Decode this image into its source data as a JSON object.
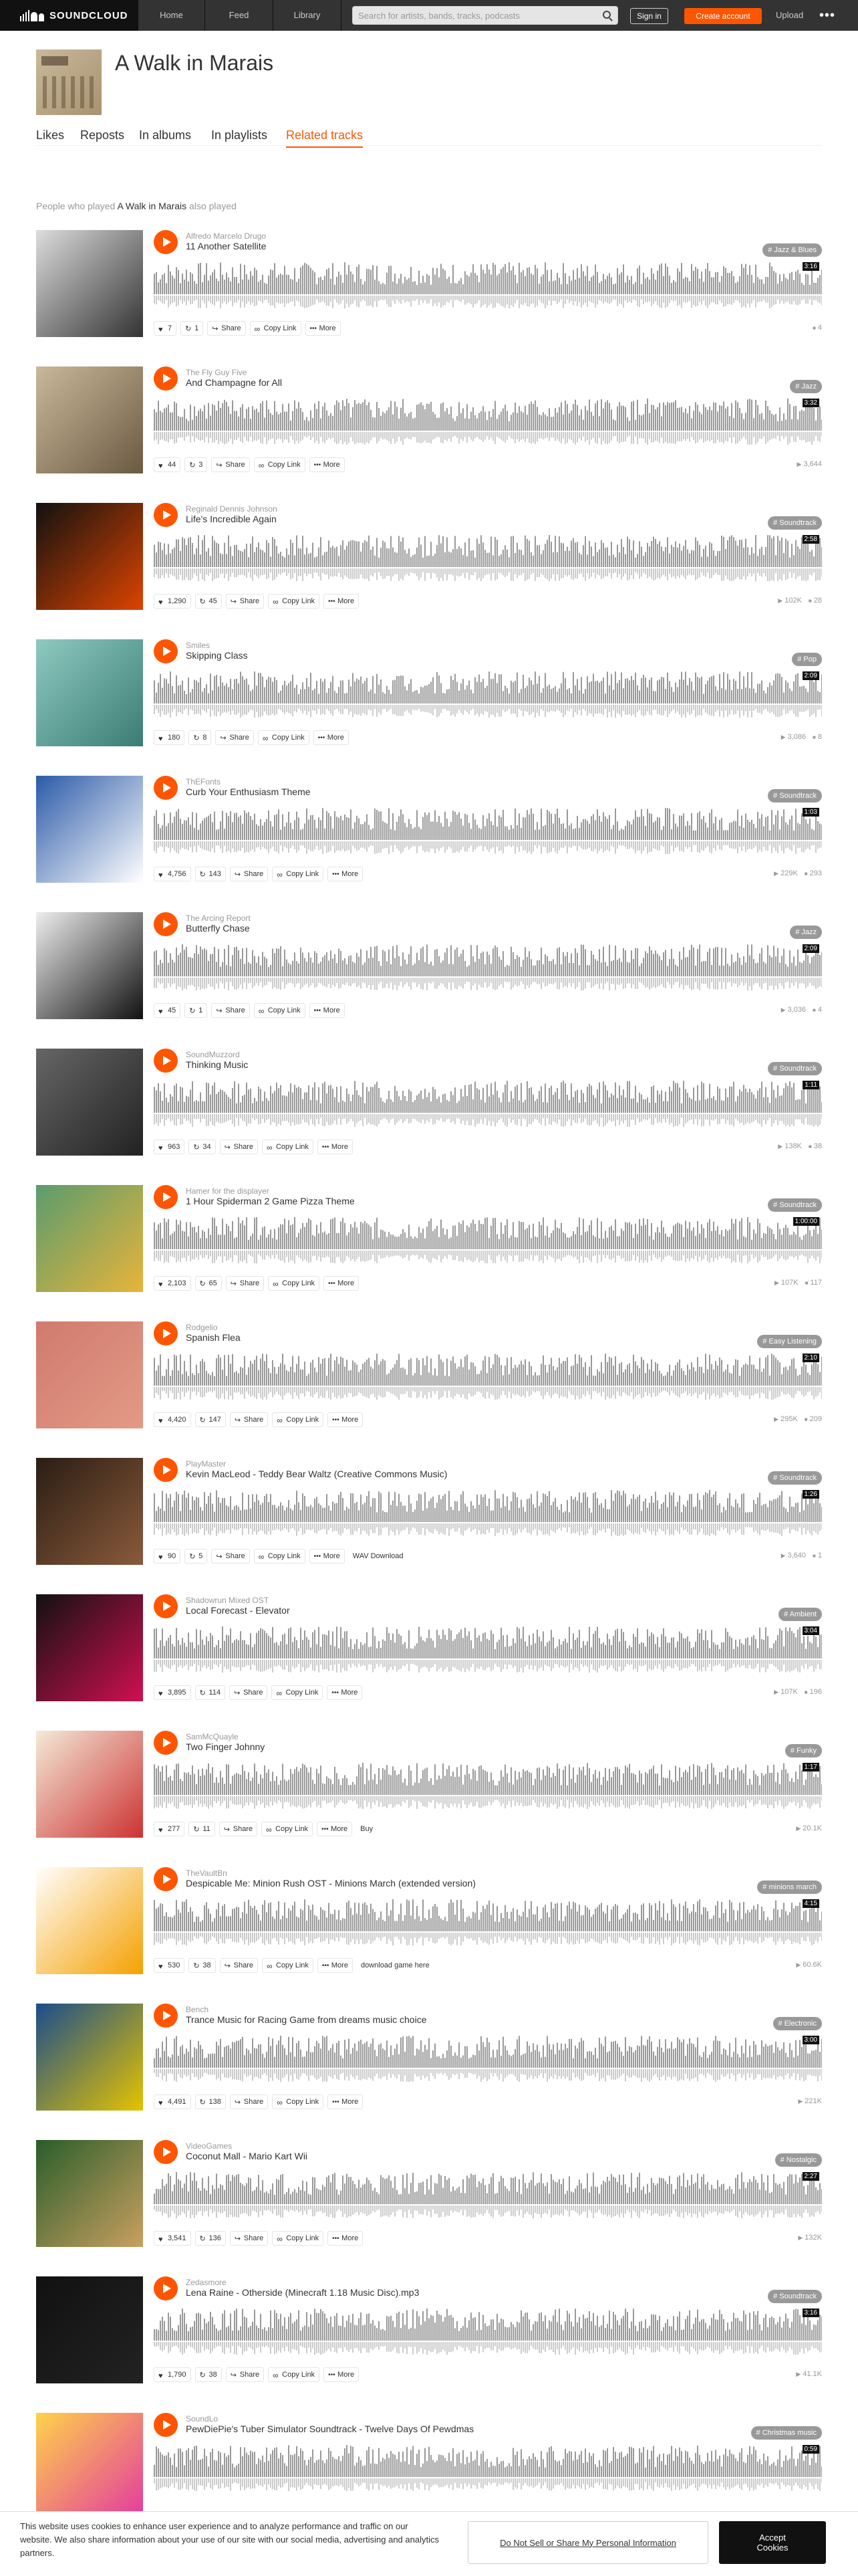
{
  "nav": {
    "logo_text": "SOUNDCLOUD",
    "home": "Home",
    "feed": "Feed",
    "library": "Library",
    "search_placeholder": "Search for artists, bands, tracks, podcasts",
    "sign_in": "Sign in",
    "create_account": "Create account",
    "upload": "Upload",
    "more": "•••"
  },
  "hero": {
    "title": "A Walk in Marais",
    "art": "album-cover-icon"
  },
  "tabs": [
    {
      "label": "Likes"
    },
    {
      "label": "Reposts"
    },
    {
      "label": "In albums"
    },
    {
      "label": "In playlists"
    },
    {
      "label": "Related tracks",
      "active": true
    }
  ],
  "heading": {
    "prefix": "People who played ",
    "track": "A Walk in Marais",
    "suffix": " also played"
  },
  "colors": {
    "accent": "#f50",
    "waveform": "#999",
    "nav_bg": "#333"
  },
  "tracks": [
    {
      "uploader": "Alfredo Marcelo Drugo",
      "title": "11 Another Satellite",
      "date": "",
      "tag": "# Jazz & Blues",
      "duration": "3:16",
      "likes": "7",
      "reposts": "1",
      "share": "Share",
      "copy_link": "Copy Link",
      "more": "More",
      "buy": "",
      "plays": "",
      "comments": "4",
      "art_colors": [
        "#ddd",
        "#333"
      ]
    },
    {
      "uploader": "The Fly Guy Five",
      "title": "And Champagne for All",
      "date": "",
      "tag": "# Jazz",
      "duration": "3:32",
      "likes": "44",
      "reposts": "3",
      "share": "Share",
      "copy_link": "Copy Link",
      "more": "More",
      "buy": "",
      "plays": "3,644",
      "comments": "",
      "art_colors": [
        "#c9b99a",
        "#6b5a43"
      ]
    },
    {
      "uploader": "Reginald Dennis Johnson",
      "title": "Life's Incredible Again",
      "date": "",
      "tag": "# Soundtrack",
      "duration": "2:58",
      "likes": "1,290",
      "reposts": "45",
      "share": "Share",
      "copy_link": "Copy Link",
      "more": "More",
      "buy": "",
      "plays": "102K",
      "comments": "28",
      "art_colors": [
        "#111",
        "#d40"
      ]
    },
    {
      "uploader": "Smiles",
      "title": "Skipping Class",
      "date": "",
      "tag": "# Pop",
      "duration": "2:09",
      "likes": "180",
      "reposts": "8",
      "share": "Share",
      "copy_link": "Copy Link",
      "more": "More",
      "buy": "",
      "plays": "3,086",
      "comments": "8",
      "art_colors": [
        "#8fc9c0",
        "#3a7d74"
      ]
    },
    {
      "uploader": "ThEFonts",
      "title": "Curb Your Enthusiasm Theme",
      "date": "",
      "tag": "# Soundtrack",
      "duration": "1:03",
      "likes": "4,756",
      "reposts": "143",
      "share": "Share",
      "copy_link": "Copy Link",
      "more": "More",
      "buy": "",
      "plays": "229K",
      "comments": "293",
      "art_colors": [
        "#2b5aa8",
        "#fff"
      ]
    },
    {
      "uploader": "The Arcing Report",
      "title": "Butterfly Chase",
      "date": "",
      "tag": "# Jazz",
      "duration": "2:09",
      "likes": "45",
      "reposts": "1",
      "share": "Share",
      "copy_link": "Copy Link",
      "more": "More",
      "buy": "",
      "plays": "3,036",
      "comments": "4",
      "art_colors": [
        "#eee",
        "#111"
      ]
    },
    {
      "uploader": "SoundMuzzord",
      "title": "Thinking Music",
      "date": "",
      "tag": "# Soundtrack",
      "duration": "1:11",
      "likes": "963",
      "reposts": "34",
      "share": "Share",
      "copy_link": "Copy Link",
      "more": "More",
      "buy": "",
      "plays": "138K",
      "comments": "38",
      "art_colors": [
        "#666",
        "#222"
      ]
    },
    {
      "uploader": "Hamer for the displayer",
      "title": "1 Hour Spiderman 2 Game Pizza Theme",
      "date": "",
      "tag": "# Soundtrack",
      "duration": "1:00:00",
      "likes": "2,103",
      "reposts": "65",
      "share": "Share",
      "copy_link": "Copy Link",
      "more": "More",
      "buy": "",
      "plays": "107K",
      "comments": "117",
      "art_colors": [
        "#5a9c6e",
        "#e8b43a"
      ]
    },
    {
      "uploader": "Rodgelio",
      "title": "Spanish Flea",
      "date": "",
      "tag": "# Easy Listening",
      "duration": "2:10",
      "likes": "4,420",
      "reposts": "147",
      "share": "Share",
      "copy_link": "Copy Link",
      "more": "More",
      "buy": "",
      "plays": "295K",
      "comments": "209",
      "art_colors": [
        "#d07a6e",
        "#e39a86"
      ]
    },
    {
      "uploader": "PlayMaster",
      "title": "Kevin MacLeod - Teddy Bear Waltz (Creative Commons Music)",
      "date": "",
      "tag": "# Soundtrack",
      "duration": "1:26",
      "likes": "90",
      "reposts": "5",
      "share": "Share",
      "copy_link": "Copy Link",
      "more": "More",
      "buy": "WAV Download",
      "plays": "3,640",
      "comments": "1",
      "art_colors": [
        "#2a1d14",
        "#8a5a3a"
      ]
    },
    {
      "uploader": "Shadowrun Mixed OST",
      "title": "Local Forecast - Elevator",
      "date": "",
      "tag": "# Ambient",
      "duration": "3:04",
      "likes": "3,895",
      "reposts": "114",
      "share": "Share",
      "copy_link": "Copy Link",
      "more": "More",
      "buy": "",
      "plays": "107K",
      "comments": "196",
      "art_colors": [
        "#111",
        "#d01050"
      ]
    },
    {
      "uploader": "SamMcQuayle",
      "title": "Two Finger Johnny",
      "date": "",
      "tag": "# Funky",
      "duration": "1:17",
      "likes": "277",
      "reposts": "11",
      "share": "Share",
      "copy_link": "Copy Link",
      "more": "More",
      "buy": "Buy",
      "plays": "20.1K",
      "comments": "",
      "art_colors": [
        "#f4ead8",
        "#c33"
      ]
    },
    {
      "uploader": "TheVaultBn",
      "title": "Despicable Me: Minion Rush OST - Minions March (extended version)",
      "date": "",
      "tag": "# minions march",
      "duration": "4:15",
      "likes": "530",
      "reposts": "38",
      "share": "Share",
      "copy_link": "Copy Link",
      "more": "More",
      "buy": "download game here",
      "plays": "60.6K",
      "comments": "",
      "art_colors": [
        "#fff",
        "#f5a000"
      ]
    },
    {
      "uploader": "Bench",
      "title": "Trance Music for Racing Game from dreams music choice",
      "date": "",
      "tag": "# Electronic",
      "duration": "3:00",
      "likes": "4,491",
      "reposts": "138",
      "share": "Share",
      "copy_link": "Copy Link",
      "more": "More",
      "buy": "",
      "plays": "221K",
      "comments": "",
      "art_colors": [
        "#1a4d8c",
        "#e5c300"
      ]
    },
    {
      "uploader": "VideoGames",
      "title": "Coconut Mall - Mario Kart Wii",
      "date": "",
      "tag": "# Nostalgic",
      "duration": "2:27",
      "likes": "3,541",
      "reposts": "136",
      "share": "Share",
      "copy_link": "Copy Link",
      "more": "More",
      "buy": "",
      "plays": "132K",
      "comments": "",
      "art_colors": [
        "#2a5d2a",
        "#c9a060"
      ]
    },
    {
      "uploader": "Zedasmore",
      "title": "Lena Raine - Otherside (Minecraft 1.18 Music Disc).mp3",
      "date": "",
      "tag": "# Soundtrack",
      "duration": "3:16",
      "likes": "1,790",
      "reposts": "38",
      "share": "Share",
      "copy_link": "Copy Link",
      "more": "More",
      "buy": "",
      "plays": "41.1K",
      "comments": "",
      "art_colors": [
        "#111",
        "#222"
      ]
    },
    {
      "uploader": "SoundLo",
      "title": "PewDiePie's Tuber Simulator Soundtrack - Twelve Days Of Pewdmas",
      "date": "",
      "tag": "# Christmas music",
      "duration": "0:59",
      "likes": "",
      "reposts": "",
      "share": "",
      "copy_link": "",
      "more": "",
      "buy": "",
      "plays": "",
      "comments": "",
      "art_colors": [
        "#ffd24a",
        "#e23aa0"
      ]
    }
  ],
  "cookie": {
    "text": "This website uses cookies to enhance user experience and to analyze performance and traffic on our website. We also share information about your use of our site with our social media, advertising and analytics partners.",
    "link": "Do Not Sell or Share My Personal Information",
    "accept": "Accept Cookies"
  }
}
